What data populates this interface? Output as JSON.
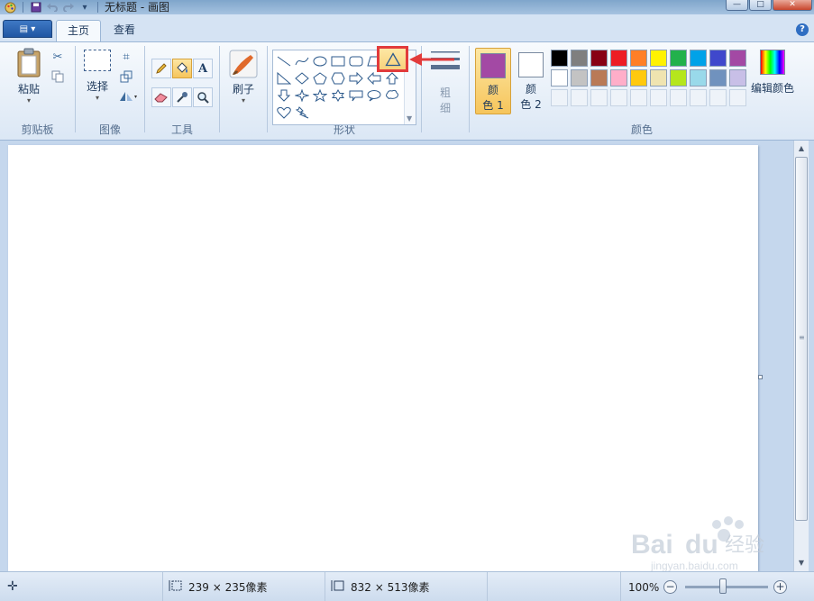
{
  "window": {
    "title": "无标题 - 画图",
    "controls": {
      "minimize": "—",
      "maximize": "□",
      "close": "✕"
    }
  },
  "quick_access": {
    "dropdown": "▾"
  },
  "ribbon_tabs": [
    {
      "label": "主页",
      "active": true
    },
    {
      "label": "查看",
      "active": false
    }
  ],
  "app_menu": {
    "label": "▤ ▾"
  },
  "help": {
    "label": "?"
  },
  "groups": {
    "clipboard": {
      "label": "剪贴板",
      "paste": "粘贴"
    },
    "image": {
      "label": "图像",
      "select": "选择"
    },
    "tools": {
      "label": "工具"
    },
    "brushes": {
      "label": "刷子"
    },
    "shapes": {
      "label": "形状",
      "selected_shape": "triangle"
    },
    "size": {
      "label_1": "粗",
      "label_2": "细"
    },
    "colors": {
      "label": "颜色",
      "color1_label_1": "颜",
      "color1_label_2": "色 1",
      "color2_label_1": "颜",
      "color2_label_2": "色 2",
      "edit_colors": "编辑颜色",
      "color1_value": "#a349a4",
      "color2_value": "#ffffff",
      "palette_row1": [
        "#000000",
        "#7f7f7f",
        "#880015",
        "#ed1c24",
        "#ff7f27",
        "#fff200",
        "#22b14c",
        "#00a2e8",
        "#3f48cc",
        "#a349a4"
      ],
      "palette_row2": [
        "#ffffff",
        "#c3c3c3",
        "#b97a57",
        "#ffaec9",
        "#ffc90e",
        "#efe4b0",
        "#b5e61d",
        "#99d9ea",
        "#7092be",
        "#c8bfe7"
      ]
    }
  },
  "status": {
    "selection_size": "239 × 235像素",
    "canvas_size": "832 × 513像素",
    "zoom": "100%",
    "zoom_out": "−",
    "zoom_in": "+"
  },
  "watermark": {
    "brand": "Bai",
    "brand2": "du",
    "suffix": "经验",
    "url": "jingyan.baidu.com"
  }
}
